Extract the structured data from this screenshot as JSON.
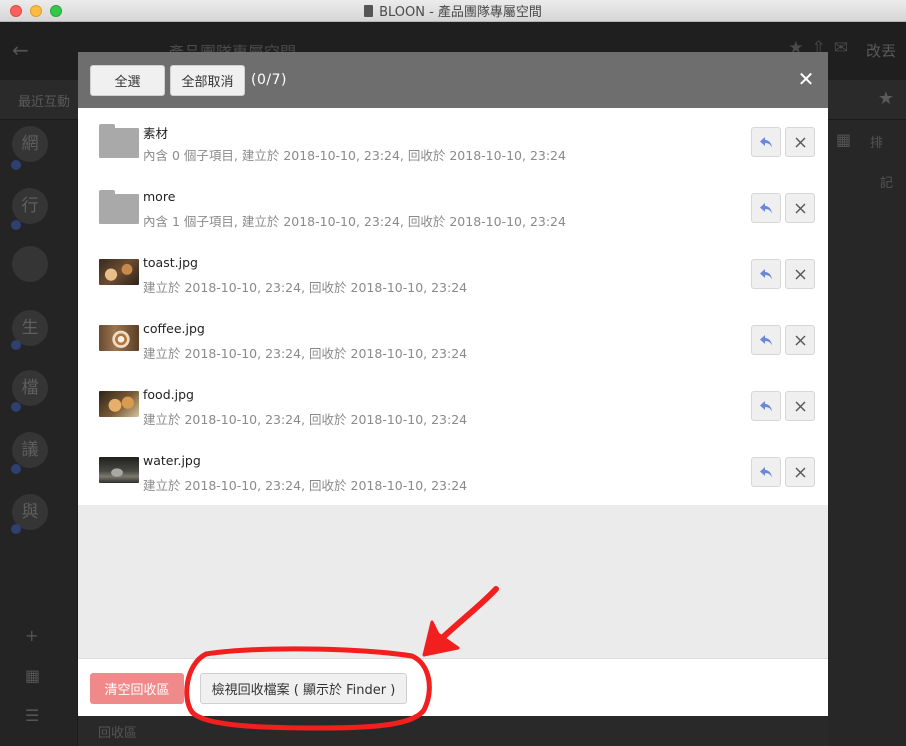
{
  "window": {
    "title": "BLOON - 產品團隊專屬空間",
    "icon": "bloon-app-icon"
  },
  "background_app": {
    "space_name": "產品團隊專屬空間",
    "right_action": "改丟",
    "tab_recent": "最近互動",
    "sort_label": "排",
    "side_label": "記",
    "trash_label": "回收區",
    "rail_avatars": [
      "網",
      "行",
      "",
      "生",
      "檔",
      "議",
      "與"
    ]
  },
  "modal": {
    "select_all_label": "全選",
    "deselect_all_label": "全部取消",
    "selection_count": "(0/7)",
    "close_icon": "close-icon",
    "files": [
      {
        "name": "素材",
        "meta": "內含 0 個子項目, 建立於 2018-10-10, 23:24, 回收於 2018-10-10, 23:24",
        "kind": "folder"
      },
      {
        "name": "more",
        "meta": "內含 1 個子項目, 建立於 2018-10-10, 23:24, 回收於 2018-10-10, 23:24",
        "kind": "folder"
      },
      {
        "name": "toast.jpg",
        "meta": "建立於 2018-10-10, 23:24, 回收於 2018-10-10, 23:24",
        "kind": "image"
      },
      {
        "name": "coffee.jpg",
        "meta": "建立於 2018-10-10, 23:24, 回收於 2018-10-10, 23:24",
        "kind": "image"
      },
      {
        "name": "food.jpg",
        "meta": "建立於 2018-10-10, 23:24, 回收於 2018-10-10, 23:24",
        "kind": "image"
      },
      {
        "name": "water.jpg",
        "meta": "建立於 2018-10-10, 23:24, 回收於 2018-10-10, 23:24",
        "kind": "image"
      }
    ],
    "empty_trash_label": "清空回收區",
    "view_trash_label": "檢視回收檔案 ( 顯示於 Finder )"
  },
  "colors": {
    "header_bg": "#6e6e6e",
    "danger_button": "#f08a8a",
    "restore_icon": "#6b87d6",
    "annotation_red": "#f21f1f"
  }
}
